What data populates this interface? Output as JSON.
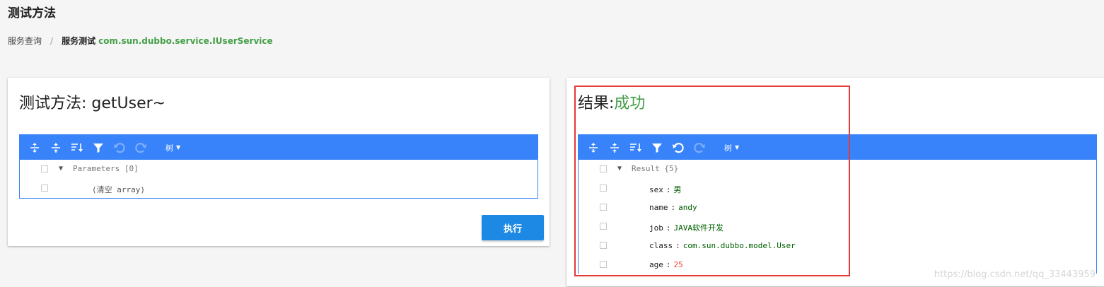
{
  "page": {
    "title": "测试方法"
  },
  "breadcrumb": {
    "parent": "服务查询",
    "separator": "/",
    "current": "服务测试",
    "service": "com.sun.dubbo.service.IUserService"
  },
  "left_card": {
    "title": "测试方法: getUser~",
    "menu": {
      "mode_label": "树"
    },
    "tree": {
      "root_key": "Parameters",
      "root_count": "[0]",
      "empty_note": "(清空 array)"
    },
    "execute_label": "执行"
  },
  "right_card": {
    "title_prefix": "结果:",
    "title_status": "成功",
    "menu": {
      "mode_label": "树"
    },
    "tree": {
      "root_key": "Result",
      "root_count": "{5}",
      "rows": [
        {
          "key": "sex",
          "sep": ":",
          "value": "男",
          "type": "string"
        },
        {
          "key": "name",
          "sep": ":",
          "value": "andy",
          "type": "string"
        },
        {
          "key": "job",
          "sep": ":",
          "value": "JAVA软件开发",
          "type": "string"
        },
        {
          "key": "class",
          "sep": ":",
          "value": "com.sun.dubbo.model.User",
          "type": "string"
        },
        {
          "key": "age",
          "sep": ":",
          "value": "25",
          "type": "number"
        }
      ]
    }
  },
  "watermark": "https://blog.csdn.net/qq_33443959",
  "colors": {
    "accent": "#3883fa",
    "success": "#43a047",
    "button": "#1e88e5",
    "highlight": "#e53935",
    "string_value": "#006000",
    "number_value": "#ee422e"
  },
  "icons": [
    "expand-all-icon",
    "collapse-all-icon",
    "sort-icon",
    "filter-icon",
    "undo-icon",
    "redo-icon"
  ]
}
